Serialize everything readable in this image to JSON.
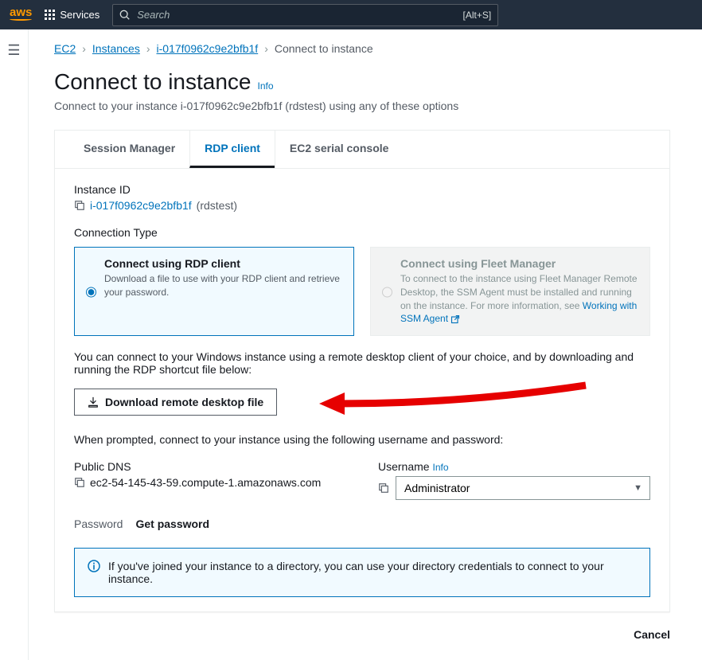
{
  "nav": {
    "logo": "aws",
    "services": "Services",
    "search_placeholder": "Search",
    "shortcut": "[Alt+S]"
  },
  "crumbs": {
    "ec2": "EC2",
    "instances": "Instances",
    "instance_id": "i-017f0962c9e2bfb1f",
    "current": "Connect to instance"
  },
  "header": {
    "title": "Connect to instance",
    "info": "Info",
    "subtitle": "Connect to your instance i-017f0962c9e2bfb1f (rdstest) using any of these options"
  },
  "tabs": {
    "session": "Session Manager",
    "rdp": "RDP client",
    "serial": "EC2 serial console"
  },
  "instance": {
    "label": "Instance ID",
    "id": "i-017f0962c9e2bfb1f",
    "name": "(rdstest)"
  },
  "conn_type": {
    "label": "Connection Type",
    "opt1_title": "Connect using RDP client",
    "opt1_desc": "Download a file to use with your RDP client and retrieve your password.",
    "opt2_title": "Connect using Fleet Manager",
    "opt2_desc_1": "To connect to the instance using Fleet Manager Remote Desktop, the SSM Agent must be installed and running on the instance. For more information, see ",
    "opt2_link": "Working with SSM Agent"
  },
  "para1": "You can connect to your Windows instance using a remote desktop client of your choice, and by downloading and running the RDP shortcut file below:",
  "download_btn": "Download remote desktop file",
  "para2": "When prompted, connect to your instance using the following username and password:",
  "fields": {
    "dns_label": "Public DNS",
    "dns_value": "ec2-54-145-43-59.compute-1.amazonaws.com",
    "user_label": "Username",
    "user_info": "Info",
    "user_value": "Administrator"
  },
  "password": {
    "label": "Password",
    "get": "Get password"
  },
  "infobox": "If you've joined your instance to a directory, you can use your directory credentials to connect to your instance.",
  "footer": {
    "cancel": "Cancel"
  }
}
